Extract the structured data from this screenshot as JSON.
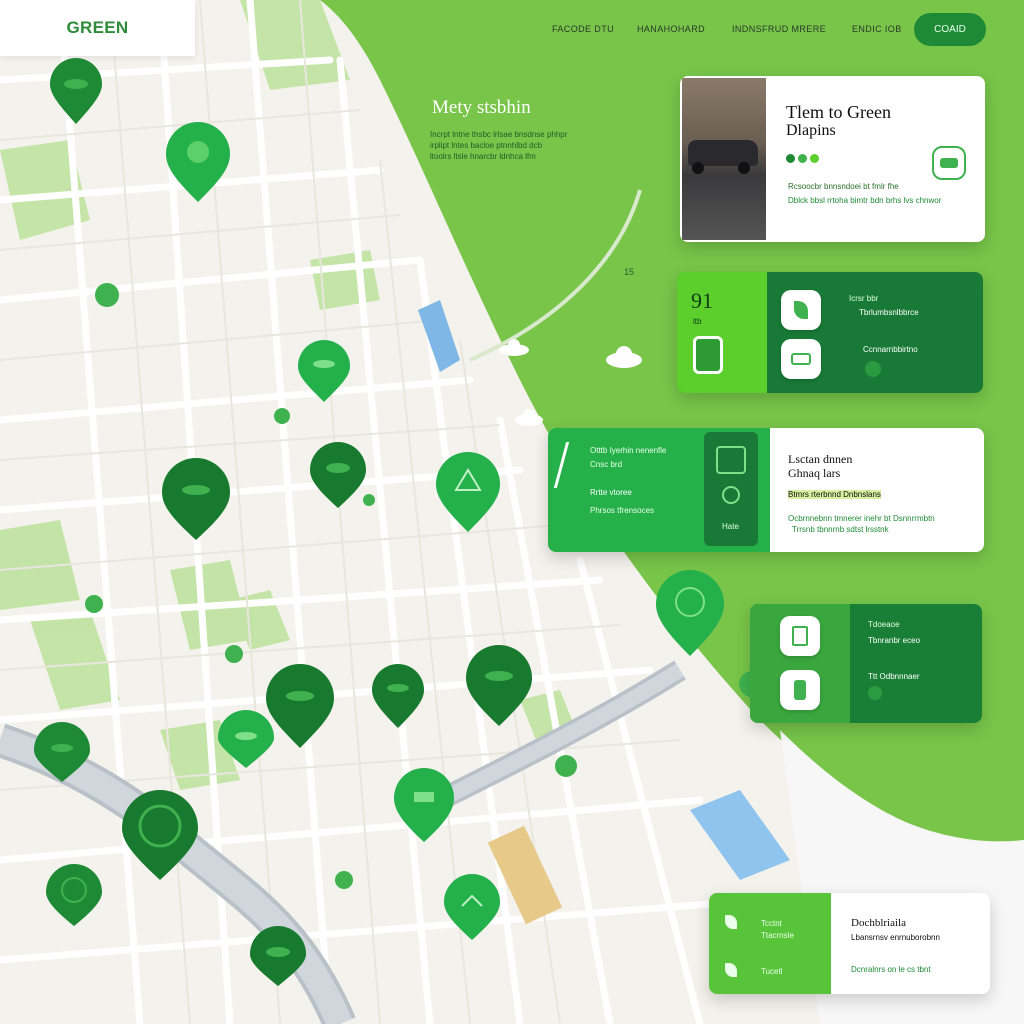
{
  "brand": {
    "logo": "GREEN"
  },
  "nav": {
    "items": [
      "FACODE DTU",
      "HANAHOHARD",
      "INDNSFRUD MRERE",
      "ENDIC IOB"
    ],
    "cta": "COAID"
  },
  "hero": {
    "title": "Mety stsbhin",
    "lines": [
      "Incrpt lntne thsbc lrlsae bnsdnse phhpr",
      "irplipt lntes bacloe ptnnhlbd dcb",
      "ltoolrs ltsle hnarcbr ldnhca lfm"
    ]
  },
  "map": {
    "road_label": "15"
  },
  "card1": {
    "title": "Tlem to Green",
    "subtitle": "Dlapins",
    "line1": "Rcsoocbr bnnsndoei bt fmlr fhe",
    "line2": "Dblck bbsl rrtoha bimtr bdn brhs lvs chnwor"
  },
  "card2": {
    "number": "91",
    "sub": "ltb",
    "row1": "Icrsr bbr",
    "row1b": "Tbrlumbsnlbbrce",
    "row2": "Ccnnarnbbirtno"
  },
  "card3": {
    "head1": "Otttb Iyerhin nenenfle",
    "head2": "Cnsc brd",
    "mid": "Rrtte vtoree",
    "line1": "Phrsos tfrensoces",
    "tag": "Hate",
    "title": "Lsctan dnnen",
    "subtitle": "Ghnaq lars",
    "line2": "Btmrs rterbnnd Dnbnslans",
    "line3": "Ocbrnnebnn tmnerer inehr bt Dsnnrrmbtn",
    "line4": "Trrsnb tbnnrnb sdtst lrsstnk"
  },
  "card4": {
    "row1": "Tdoeaoe",
    "row1b": "Tbnranbr eceo",
    "row2": "Ttt Odbnnnaer"
  },
  "card5": {
    "left1": "Tcctnt",
    "left1b": "Ttacrnsle",
    "left2": "Tucetl",
    "title": "Dochblriaila",
    "line1": "Lbansrnsv enrnuborobnn",
    "line2": "Dcnralnrs on le cs tbnt"
  },
  "colors": {
    "accent": "#1f8a36",
    "green_bg": "#78c54a",
    "lime": "#5ccf2c",
    "map_bg": "#f4f2ec"
  }
}
